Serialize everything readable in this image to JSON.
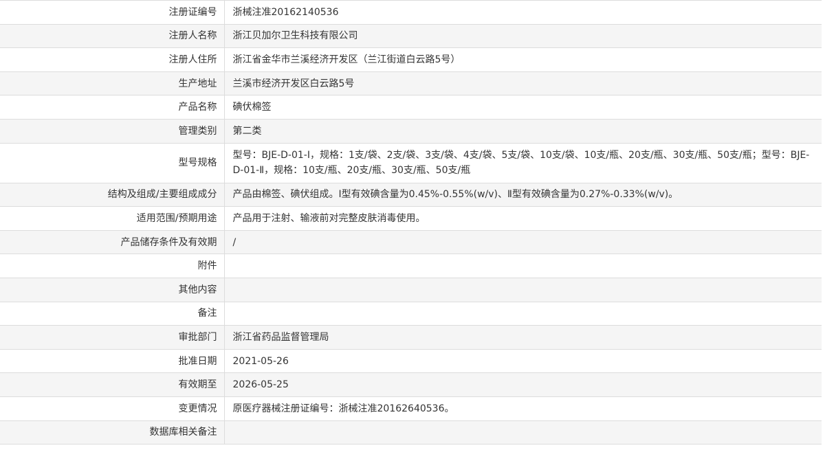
{
  "rows": [
    {
      "label": "注册证编号",
      "value": "浙械注准20162140536"
    },
    {
      "label": "注册人名称",
      "value": "浙江贝加尔卫生科技有限公司"
    },
    {
      "label": "注册人住所",
      "value": "浙江省金华市兰溪经济开发区（兰江街道白云路5号）"
    },
    {
      "label": "生产地址",
      "value": "兰溪市经济开发区白云路5号"
    },
    {
      "label": "产品名称",
      "value": "碘伏棉签"
    },
    {
      "label": "管理类别",
      "value": "第二类"
    },
    {
      "label": "型号规格",
      "value": "型号：BJE-D-01-Ⅰ，规格：1支/袋、2支/袋、3支/袋、4支/袋、5支/袋、10支/袋、10支/瓶、20支/瓶、30支/瓶、50支/瓶；型号：BJE-D-01-Ⅱ，规格：10支/瓶、20支/瓶、30支/瓶、50支/瓶"
    },
    {
      "label": "结构及组成/主要组成成分",
      "value": "产品由棉签、碘伏组成。Ⅰ型有效碘含量为0.45%-0.55%(w/v)、Ⅱ型有效碘含量为0.27%-0.33%(w/v)。"
    },
    {
      "label": "适用范围/预期用途",
      "value": "产品用于注射、输液前对完整皮肤消毒使用。"
    },
    {
      "label": "产品储存条件及有效期",
      "value": "/"
    },
    {
      "label": "附件",
      "value": ""
    },
    {
      "label": "其他内容",
      "value": ""
    },
    {
      "label": "备注",
      "value": ""
    },
    {
      "label": "审批部门",
      "value": "浙江省药品监督管理局"
    },
    {
      "label": "批准日期",
      "value": "2021-05-26"
    },
    {
      "label": "有效期至",
      "value": "2026-05-25"
    },
    {
      "label": "变更情况",
      "value": "原医疗器械注册证编号：浙械注准20162640536。"
    },
    {
      "label": "数据库相关备注",
      "value": ""
    }
  ]
}
